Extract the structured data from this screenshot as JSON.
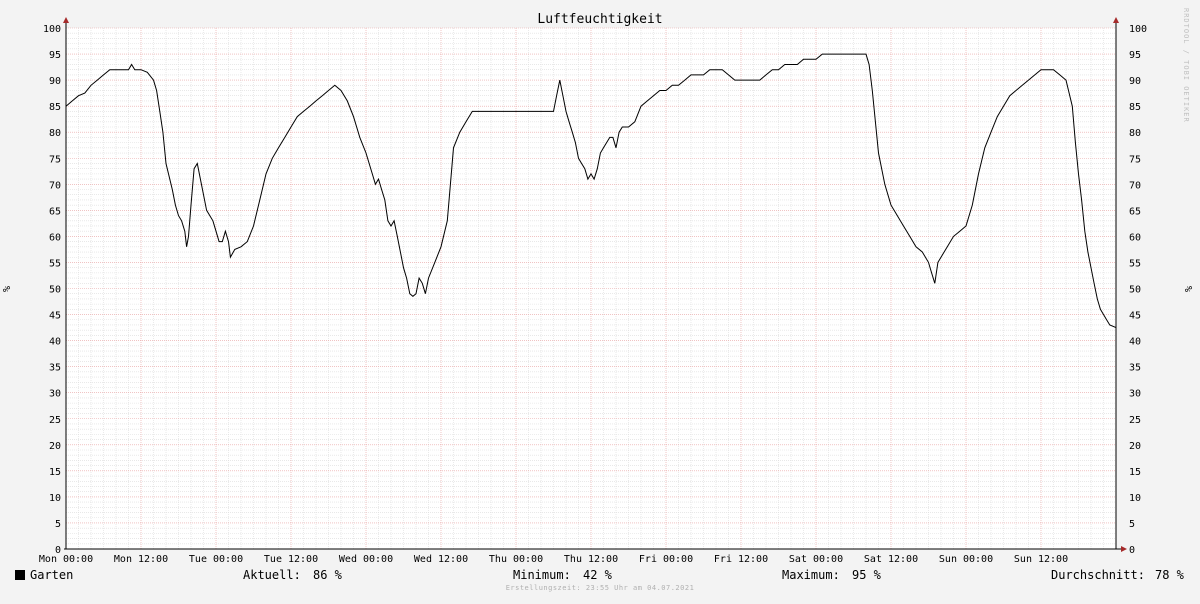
{
  "chart_data": {
    "type": "line",
    "title": "Luftfeuchtigkeit",
    "ylabel": "%",
    "ylabel_right": "%",
    "ylim": [
      0,
      100
    ],
    "y_ticks": [
      0,
      5,
      10,
      15,
      20,
      25,
      30,
      35,
      40,
      45,
      50,
      55,
      60,
      65,
      70,
      75,
      80,
      85,
      90,
      95,
      100
    ],
    "x_tick_labels": [
      "Mon 00:00",
      "Mon 12:00",
      "Tue 00:00",
      "Tue 12:00",
      "Wed 00:00",
      "Wed 12:00",
      "Thu 00:00",
      "Thu 12:00",
      "Fri 00:00",
      "Fri 12:00",
      "Sat 00:00",
      "Sat 12:00",
      "Sun 00:00",
      "Sun 12:00"
    ],
    "x_unit": "hours since Mon 00:00",
    "x_range": [
      0,
      168
    ],
    "grid": true,
    "series": [
      {
        "name": "Garten",
        "color": "#000000",
        "points": [
          [
            0,
            85
          ],
          [
            1,
            86
          ],
          [
            2,
            87
          ],
          [
            3,
            87.5
          ],
          [
            4,
            89
          ],
          [
            5,
            90
          ],
          [
            6,
            91
          ],
          [
            7,
            92
          ],
          [
            8,
            92
          ],
          [
            9,
            92
          ],
          [
            10,
            92
          ],
          [
            10.5,
            93
          ],
          [
            11,
            92
          ],
          [
            12,
            92
          ],
          [
            13,
            91.5
          ],
          [
            14,
            90
          ],
          [
            14.5,
            88
          ],
          [
            15,
            84
          ],
          [
            15.5,
            80
          ],
          [
            16,
            74
          ],
          [
            17,
            69
          ],
          [
            17.5,
            66
          ],
          [
            18,
            64
          ],
          [
            18.5,
            63
          ],
          [
            19,
            61
          ],
          [
            19.3,
            58
          ],
          [
            19.6,
            60
          ],
          [
            20,
            66
          ],
          [
            20.5,
            73
          ],
          [
            21,
            74
          ],
          [
            21.5,
            71
          ],
          [
            22,
            68
          ],
          [
            22.5,
            65
          ],
          [
            23,
            64
          ],
          [
            23.5,
            63
          ],
          [
            24,
            61
          ],
          [
            24.5,
            59
          ],
          [
            25,
            59
          ],
          [
            25.5,
            61
          ],
          [
            26,
            59
          ],
          [
            26.3,
            56
          ],
          [
            27,
            57.5
          ],
          [
            28,
            58
          ],
          [
            29,
            59
          ],
          [
            30,
            62
          ],
          [
            31,
            67
          ],
          [
            32,
            72
          ],
          [
            33,
            75
          ],
          [
            34,
            77
          ],
          [
            35,
            79
          ],
          [
            36,
            81
          ],
          [
            37,
            83
          ],
          [
            38,
            84
          ],
          [
            39,
            85
          ],
          [
            40,
            86
          ],
          [
            41,
            87
          ],
          [
            42,
            88
          ],
          [
            43,
            89
          ],
          [
            44,
            88
          ],
          [
            45,
            86
          ],
          [
            46,
            83
          ],
          [
            47,
            79
          ],
          [
            48,
            76
          ],
          [
            49,
            72
          ],
          [
            49.5,
            70
          ],
          [
            50,
            71
          ],
          [
            50.5,
            69
          ],
          [
            51,
            67
          ],
          [
            51.5,
            63
          ],
          [
            52,
            62
          ],
          [
            52.5,
            63
          ],
          [
            53,
            60
          ],
          [
            53.5,
            57
          ],
          [
            54,
            54
          ],
          [
            54.5,
            52
          ],
          [
            55,
            49
          ],
          [
            55.5,
            48.5
          ],
          [
            56,
            49
          ],
          [
            56.5,
            52
          ],
          [
            57,
            51
          ],
          [
            57.5,
            49
          ],
          [
            58,
            52
          ],
          [
            59,
            55
          ],
          [
            60,
            58
          ],
          [
            61,
            63
          ],
          [
            61.5,
            70
          ],
          [
            62,
            77
          ],
          [
            63,
            80
          ],
          [
            64,
            82
          ],
          [
            65,
            84
          ],
          [
            66,
            84
          ],
          [
            70,
            84
          ],
          [
            74,
            84
          ],
          [
            75,
            84
          ],
          [
            76,
            84
          ],
          [
            77,
            84
          ],
          [
            78,
            84
          ],
          [
            78.5,
            87
          ],
          [
            79,
            90
          ],
          [
            79.5,
            87
          ],
          [
            80,
            84
          ],
          [
            80.5,
            82
          ],
          [
            81,
            80
          ],
          [
            81.5,
            78
          ],
          [
            82,
            75
          ],
          [
            82.5,
            74
          ],
          [
            83,
            73
          ],
          [
            83.5,
            71
          ],
          [
            84,
            72
          ],
          [
            84.5,
            71
          ],
          [
            85,
            73
          ],
          [
            85.5,
            76
          ],
          [
            86,
            77
          ],
          [
            86.5,
            78
          ],
          [
            87,
            79
          ],
          [
            87.5,
            79
          ],
          [
            88,
            77
          ],
          [
            88.5,
            80
          ],
          [
            89,
            81
          ],
          [
            90,
            81
          ],
          [
            91,
            82
          ],
          [
            92,
            85
          ],
          [
            93,
            86
          ],
          [
            94,
            87
          ],
          [
            95,
            88
          ],
          [
            96,
            88
          ],
          [
            97,
            89
          ],
          [
            98,
            89
          ],
          [
            99,
            90
          ],
          [
            100,
            91
          ],
          [
            101,
            91
          ],
          [
            102,
            91
          ],
          [
            103,
            92
          ],
          [
            104,
            92
          ],
          [
            105,
            92
          ],
          [
            106,
            91
          ],
          [
            107,
            90
          ],
          [
            108,
            90
          ],
          [
            109,
            90
          ],
          [
            110,
            90
          ],
          [
            111,
            90
          ],
          [
            112,
            91
          ],
          [
            113,
            92
          ],
          [
            114,
            92
          ],
          [
            115,
            93
          ],
          [
            116,
            93
          ],
          [
            117,
            93
          ],
          [
            118,
            94
          ],
          [
            119,
            94
          ],
          [
            120,
            94
          ],
          [
            121,
            95
          ],
          [
            122,
            95
          ],
          [
            123,
            95
          ],
          [
            124,
            95
          ],
          [
            125,
            95
          ],
          [
            126,
            95
          ],
          [
            127,
            95
          ],
          [
            128,
            95
          ],
          [
            128.5,
            93
          ],
          [
            129,
            88
          ],
          [
            129.5,
            82
          ],
          [
            130,
            76
          ],
          [
            131,
            70
          ],
          [
            132,
            66
          ],
          [
            133,
            64
          ],
          [
            134,
            62
          ],
          [
            135,
            60
          ],
          [
            136,
            58
          ],
          [
            137,
            57
          ],
          [
            138,
            55
          ],
          [
            138.5,
            53
          ],
          [
            139,
            51
          ],
          [
            139.5,
            55
          ],
          [
            140,
            56
          ],
          [
            141,
            58
          ],
          [
            142,
            60
          ],
          [
            143,
            61
          ],
          [
            144,
            62
          ],
          [
            145,
            66
          ],
          [
            146,
            72
          ],
          [
            147,
            77
          ],
          [
            148,
            80
          ],
          [
            149,
            83
          ],
          [
            150,
            85
          ],
          [
            151,
            87
          ],
          [
            152,
            88
          ],
          [
            153,
            89
          ],
          [
            154,
            90
          ],
          [
            155,
            91
          ],
          [
            156,
            92
          ],
          [
            157,
            92
          ],
          [
            158,
            92
          ],
          [
            159,
            91
          ],
          [
            160,
            90
          ],
          [
            161,
            85
          ],
          [
            161.5,
            78
          ],
          [
            162,
            72
          ],
          [
            162.5,
            67
          ],
          [
            163,
            61
          ],
          [
            163.5,
            57
          ],
          [
            164,
            54
          ],
          [
            164.5,
            51
          ],
          [
            165,
            48
          ],
          [
            165.5,
            46
          ],
          [
            166,
            45
          ],
          [
            166.5,
            44
          ],
          [
            167,
            43
          ],
          [
            168,
            42.5
          ]
        ]
      }
    ],
    "legend": {
      "series_label": "Garten",
      "aktuell_label": "Aktuell:",
      "aktuell_value": "86 %",
      "minimum_label": "Minimum:",
      "minimum_value": "42 %",
      "maximum_label": "Maximum:",
      "maximum_value": "95 %",
      "durchschnitt_label": "Durchschnitt:",
      "durchschnitt_value": "78 %"
    },
    "footer": "Erstellungszeit: 23:55 Uhr am 04.07.2021",
    "watermark": "RRDTOOL / TOBI OETIKER"
  }
}
